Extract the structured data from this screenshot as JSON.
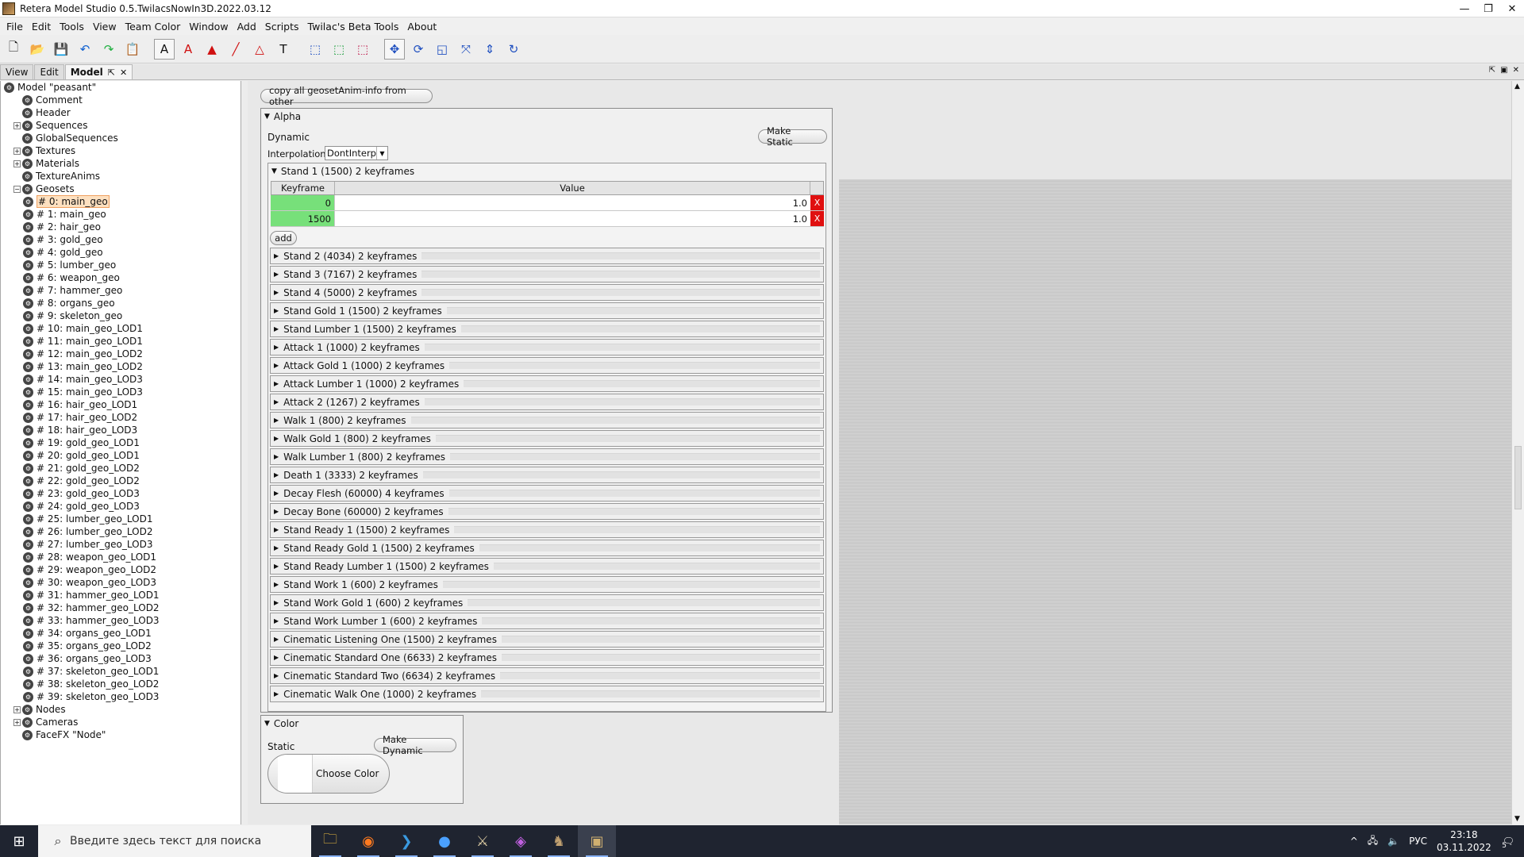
{
  "window": {
    "title": "Retera Model Studio 0.5.TwilacsNowIn3D.2022.03.12",
    "controls": [
      "—",
      "❐",
      "✕"
    ]
  },
  "menu": [
    "File",
    "Edit",
    "Tools",
    "View",
    "Team Color",
    "Window",
    "Add",
    "Scripts",
    "Twilac's Beta Tools",
    "About"
  ],
  "dock_tabs": [
    {
      "label": "View"
    },
    {
      "label": "Edit"
    },
    {
      "label": "Model",
      "active": true
    }
  ],
  "tree": {
    "root": "Model \"peasant\"",
    "top_items": [
      {
        "label": "Comment",
        "expandable": false
      },
      {
        "label": "Header",
        "expandable": false
      },
      {
        "label": "Sequences",
        "expandable": true
      },
      {
        "label": "GlobalSequences",
        "expandable": false
      },
      {
        "label": "Textures",
        "expandable": true
      },
      {
        "label": "Materials",
        "expandable": true
      },
      {
        "label": "TextureAnims",
        "expandable": false
      },
      {
        "label": "Geosets",
        "expandable": true,
        "expanded": true
      }
    ],
    "geosets": [
      "# 0: main_geo",
      "# 1: main_geo",
      "# 2: hair_geo",
      "# 3: gold_geo",
      "# 4: gold_geo",
      "# 5: lumber_geo",
      "# 6: weapon_geo",
      "# 7: hammer_geo",
      "# 8: organs_geo",
      "# 9: skeleton_geo",
      "# 10: main_geo_LOD1",
      "# 11: main_geo_LOD1",
      "# 12: main_geo_LOD2",
      "# 13: main_geo_LOD2",
      "# 14: main_geo_LOD3",
      "# 15: main_geo_LOD3",
      "# 16: hair_geo_LOD1",
      "# 17: hair_geo_LOD2",
      "# 18: hair_geo_LOD3",
      "# 19: gold_geo_LOD1",
      "# 20: gold_geo_LOD1",
      "# 21: gold_geo_LOD2",
      "# 22: gold_geo_LOD2",
      "# 23: gold_geo_LOD3",
      "# 24: gold_geo_LOD3",
      "# 25: lumber_geo_LOD1",
      "# 26: lumber_geo_LOD2",
      "# 27: lumber_geo_LOD3",
      "# 28: weapon_geo_LOD1",
      "# 29: weapon_geo_LOD2",
      "# 30: weapon_geo_LOD3",
      "# 31: hammer_geo_LOD1",
      "# 32: hammer_geo_LOD2",
      "# 33: hammer_geo_LOD3",
      "# 34: organs_geo_LOD1",
      "# 35: organs_geo_LOD2",
      "# 36: organs_geo_LOD3",
      "# 37: skeleton_geo_LOD1",
      "# 38: skeleton_geo_LOD2",
      "# 39: skeleton_geo_LOD3"
    ],
    "selected_geoset": "# 0: main_geo",
    "bottom_items": [
      {
        "label": "Nodes",
        "expandable": true
      },
      {
        "label": "Cameras",
        "expandable": true
      },
      {
        "label": "FaceFX \"Node\"",
        "expandable": false
      }
    ]
  },
  "editor": {
    "copy_button": "copy all geosetAnim-info from other",
    "alpha": {
      "header": "Alpha",
      "mode": "Dynamic",
      "make_static": "Make Static",
      "interpolation_label": "Interpolation:",
      "interpolation_value": "DontInterp",
      "expanded_sequence": "Stand 1 (1500) 2 keyframes",
      "columns": [
        "Keyframe",
        "Value"
      ],
      "keyframes": [
        {
          "keyframe": "0",
          "value": "1.0"
        },
        {
          "keyframe": "1500",
          "value": "1.0"
        }
      ],
      "delete_label": "X",
      "add_button": "add",
      "collapsed_sequences": [
        "Stand 2 (4034) 2 keyframes",
        "Stand 3 (7167) 2 keyframes",
        "Stand 4 (5000) 2 keyframes",
        "Stand Gold 1 (1500) 2 keyframes",
        "Stand Lumber 1 (1500) 2 keyframes",
        "Attack 1 (1000) 2 keyframes",
        "Attack Gold 1 (1000) 2 keyframes",
        "Attack Lumber 1 (1000) 2 keyframes",
        "Attack 2 (1267) 2 keyframes",
        "Walk 1 (800) 2 keyframes",
        "Walk Gold 1 (800) 2 keyframes",
        "Walk Lumber 1 (800) 2 keyframes",
        "Death 1 (3333) 2 keyframes",
        "Decay Flesh (60000) 4 keyframes",
        "Decay Bone (60000) 2 keyframes",
        "Stand Ready 1 (1500) 2 keyframes",
        "Stand Ready Gold 1 (1500) 2 keyframes",
        "Stand Ready Lumber 1 (1500) 2 keyframes",
        "Stand Work 1 (600) 2 keyframes",
        "Stand Work Gold 1 (600) 2 keyframes",
        "Stand Work Lumber 1 (600) 2 keyframes",
        "Cinematic Listening One (1500) 2 keyframes",
        "Cinematic Standard One (6633) 2 keyframes",
        "Cinematic Standard Two (6634) 2 keyframes",
        "Cinematic Walk One (1000) 2 keyframes"
      ]
    },
    "color": {
      "header": "Color",
      "mode": "Static",
      "make_dynamic": "Make Dynamic",
      "choose_color": "Choose Color",
      "swatch": "#ffffff"
    }
  },
  "taskbar": {
    "search_placeholder": "Введите здесь текст для поиска",
    "language": "РУС",
    "time": "23:18",
    "date": "03.11.2022",
    "notifications": "5"
  },
  "colors": {
    "keyframe_cell": "#77e07a",
    "delete_button": "#e01010",
    "selection": "#fde0c0"
  }
}
